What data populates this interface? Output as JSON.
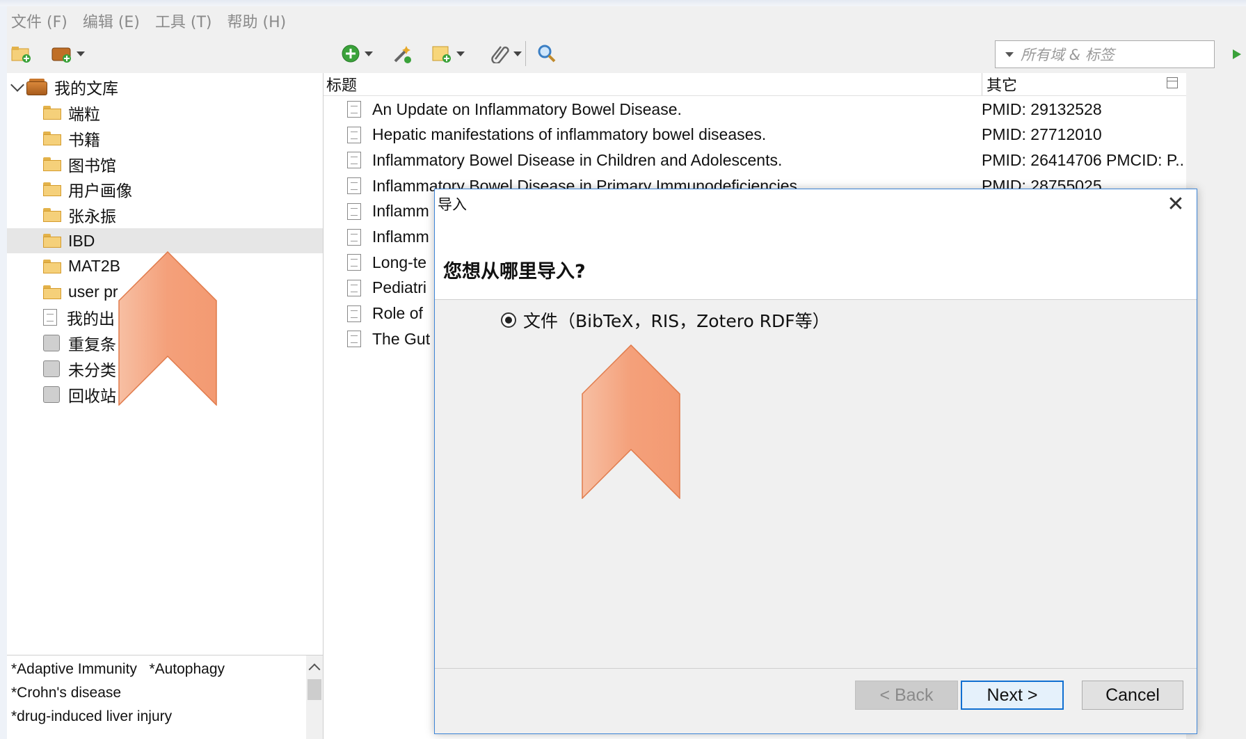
{
  "menu": [
    "文件 (F)",
    "编辑 (E)",
    "工具 (T)",
    "帮助 (H)"
  ],
  "search": {
    "placeholder": "所有域 & 标签"
  },
  "library": {
    "root": "我的文库",
    "items": [
      {
        "label": "端粒",
        "icon": "folder-icon"
      },
      {
        "label": "书籍",
        "icon": "folder-icon"
      },
      {
        "label": "图书馆",
        "icon": "folder-icon"
      },
      {
        "label": "用户画像",
        "icon": "folder-icon"
      },
      {
        "label": "张永振",
        "icon": "folder-icon"
      },
      {
        "label": "IBD",
        "icon": "folder-icon",
        "selected": true
      },
      {
        "label": "MAT2B",
        "icon": "folder-icon"
      },
      {
        "label": "user pr",
        "icon": "folder-icon"
      },
      {
        "label": "我的出",
        "icon": "publications-icon"
      },
      {
        "label": "重复条",
        "icon": "duplicates-icon"
      },
      {
        "label": "未分类",
        "icon": "unfiled-icon"
      },
      {
        "label": "回收站",
        "icon": "trash-icon"
      }
    ]
  },
  "tags": [
    "*Adaptive Immunity",
    "*Autophagy",
    "*Crohn's disease",
    "*drug-induced liver injury"
  ],
  "columns": {
    "title": "标题",
    "extra": "其它"
  },
  "items": [
    {
      "title": "An Update on Inflammatory Bowel Disease.",
      "extra": "PMID: 29132528"
    },
    {
      "title": "Hepatic manifestations of inflammatory bowel diseases.",
      "extra": "PMID: 27712010"
    },
    {
      "title": "Inflammatory Bowel Disease in Children and Adolescents.",
      "extra": "PMID: 26414706  PMCID: P..."
    },
    {
      "title": "Inflammatory Bowel Disease in Primary Immunodeficiencies.",
      "extra": "PMID: 28755025"
    },
    {
      "title": "Inflamm",
      "extra": ""
    },
    {
      "title": "Inflamm",
      "extra": ""
    },
    {
      "title": "Long-te",
      "extra": ""
    },
    {
      "title": "Pediatri",
      "extra": ""
    },
    {
      "title": "Role of",
      "extra": ""
    },
    {
      "title": "The Gut",
      "extra": ""
    }
  ],
  "dialog": {
    "title": "导入",
    "question": "您想从哪里导入?",
    "option": "文件（BibTeX，RIS，Zotero RDF等）",
    "back": "< Back",
    "next": "Next >",
    "cancel": "Cancel"
  },
  "colors": {
    "accent": "#0f6fd1",
    "arrow": "#f4a07a"
  }
}
